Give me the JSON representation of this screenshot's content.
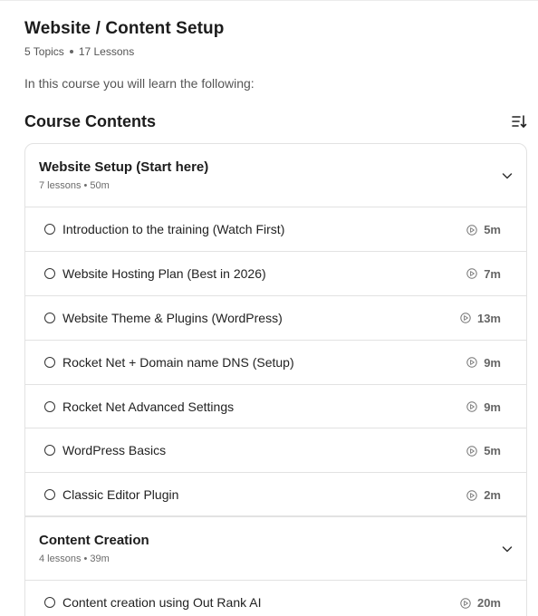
{
  "course": {
    "title": "Website / Content Setup",
    "topics": "5 Topics",
    "lessons": "17 Lessons",
    "intro": "In this course you will learn the following:"
  },
  "contents": {
    "heading": "Course Contents",
    "sort_icon": "sort-icon"
  },
  "sections": [
    {
      "title": "Website Setup (Start here)",
      "meta": "7 lessons • 50m",
      "expanded": true,
      "lessons": [
        {
          "title": "Introduction to the training (Watch First)",
          "duration": "5m"
        },
        {
          "title": "Website Hosting Plan (Best in 2026)",
          "duration": "7m"
        },
        {
          "title": "Website Theme & Plugins (WordPress)",
          "duration": "13m"
        },
        {
          "title": "Rocket Net + Domain name DNS (Setup)",
          "duration": "9m"
        },
        {
          "title": "Rocket Net Advanced Settings",
          "duration": "9m"
        },
        {
          "title": "WordPress Basics",
          "duration": "5m"
        },
        {
          "title": "Classic Editor Plugin",
          "duration": "2m"
        }
      ]
    },
    {
      "title": "Content Creation",
      "meta": "4 lessons • 39m",
      "expanded": true,
      "lessons": [
        {
          "title": "Content creation using Out Rank AI",
          "duration": "20m"
        }
      ]
    }
  ],
  "icons": {
    "chevron": "chevron-down-icon",
    "play": "play-circle-icon",
    "status": "circle-outline-icon"
  }
}
